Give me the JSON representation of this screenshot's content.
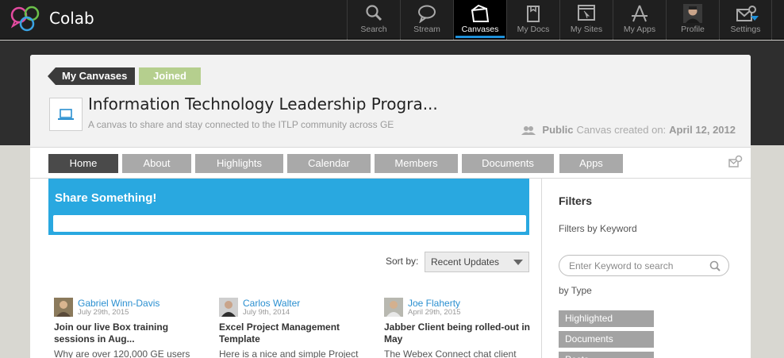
{
  "app": {
    "name": "Colab"
  },
  "nav": [
    {
      "label": "Search",
      "icon": "search-icon"
    },
    {
      "label": "Stream",
      "icon": "chat-bubble-icon"
    },
    {
      "label": "Canvases",
      "icon": "canvases-icon",
      "active": true
    },
    {
      "label": "My Docs",
      "icon": "document-icon"
    },
    {
      "label": "My Sites",
      "icon": "site-icon"
    },
    {
      "label": "My Apps",
      "icon": "apps-icon"
    },
    {
      "label": "Profile",
      "icon": "profile-avatar"
    },
    {
      "label": "Settings",
      "icon": "settings-mail-icon"
    }
  ],
  "header": {
    "breadcrumb": "My Canvases",
    "joined": "Joined",
    "title": "Information Technology Leadership Progra...",
    "subtitle": "A canvas to share and stay connected to the ITLP community across GE",
    "visibility": "Public",
    "created_label": "Canvas created on:",
    "created_date": "April 12, 2012"
  },
  "tabs": [
    "Home",
    "About",
    "Highlights",
    "Calendar",
    "Members",
    "Documents",
    "Apps"
  ],
  "share": {
    "title": "Share Something!"
  },
  "sort": {
    "label": "Sort by:",
    "selected": "Recent Updates"
  },
  "posts": [
    {
      "author": "Gabriel Winn-Davis",
      "date": "July 29th, 2015",
      "title": "Join our live Box training sessions in Aug...",
      "excerpt": "Why are over 120,000 GE users"
    },
    {
      "author": "Carlos Walter",
      "date": "July 9th, 2014",
      "title": "Excel Project Management Template",
      "excerpt": "Here is a nice and simple Project"
    },
    {
      "author": "Joe Flaherty",
      "date": "April 29th, 2015",
      "title": "Jabber Client being rolled-out in May",
      "excerpt": "The Webex Connect chat client"
    }
  ],
  "filters": {
    "title": "Filters",
    "by_keyword": "Filters by Keyword",
    "keyword_placeholder": "Enter Keyword to search",
    "by_type": "by Type",
    "types": [
      "Highlighted",
      "Documents",
      "Posts"
    ]
  },
  "colors": {
    "accent": "#29a8e0",
    "active_tab_indicator": "#1e90d9",
    "joined": "#b5cf8e"
  }
}
